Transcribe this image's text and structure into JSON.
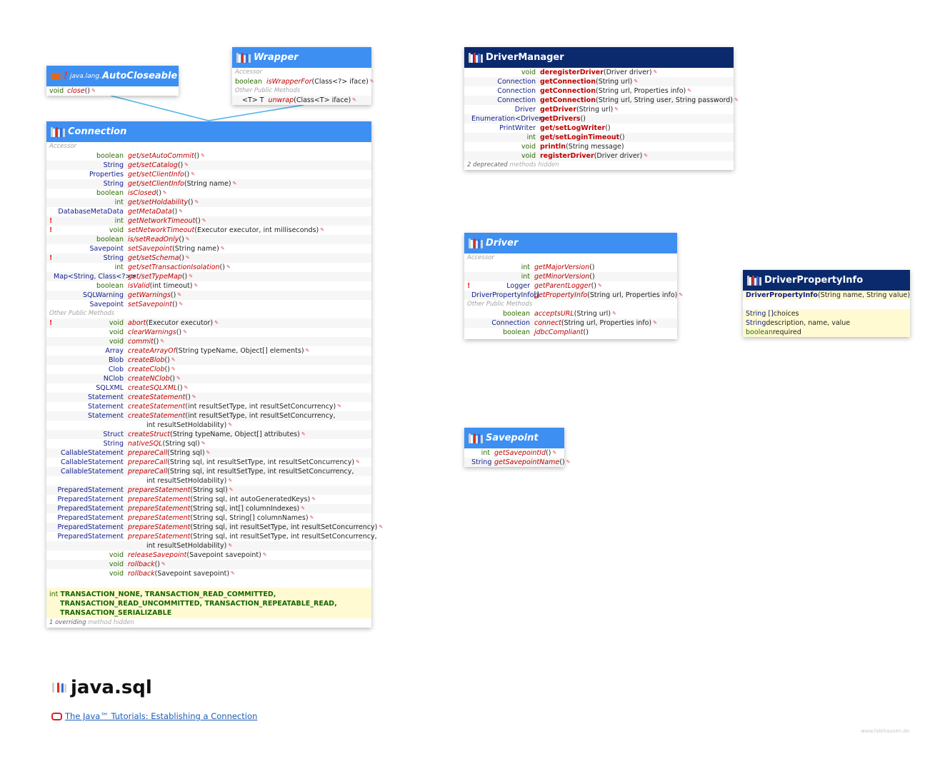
{
  "colors": {
    "interface_header": "#3d8ff2",
    "class_header": "#0b2a6e",
    "type": "#0e1c8c",
    "primitive": "#2b6b00",
    "method": "#c00000",
    "constants": "#186600",
    "connector": "#4fb4ee"
  },
  "auto": {
    "pkg": "java.lang.",
    "name": "AutoCloseable",
    "row_ret": "void",
    "row_name": "close",
    "row_params": " ()"
  },
  "wrapper": {
    "name": "Wrapper",
    "s1": "Accessor",
    "r1_ret": "boolean",
    "r1_name": "isWrapperFor",
    "r1_params": " (Class<?> iface)",
    "s2": "Other Public Methods",
    "r2_ret": "<T> T",
    "r2_name": "unwrap",
    "r2_params": " (Class<T> iface)"
  },
  "connection": {
    "name": "Connection",
    "rows": [
      {
        "s": "Accessor"
      },
      {
        "r": "boolean",
        "n": "get/setAutoCommit",
        "p": " ()",
        "t": "p"
      },
      {
        "r": "String",
        "n": "get/setCatalog",
        "p": " ()"
      },
      {
        "r": "Properties",
        "n": "get/setClientInfo",
        "p": " ()"
      },
      {
        "r": "String",
        "n": "get/setClientInfo",
        "p": " (String name)"
      },
      {
        "r": "boolean",
        "n": "isClosed",
        "p": " ()",
        "t": "p"
      },
      {
        "r": "int",
        "n": "get/setHoldability",
        "p": " ()",
        "t": "p"
      },
      {
        "r": "DatabaseMetaData",
        "n": "getMetaData",
        "p": " ()"
      },
      {
        "r": "int",
        "n": "getNetworkTimeout",
        "p": " ()",
        "t": "p",
        "b": "!"
      },
      {
        "r": "void",
        "n": "setNetworkTimeout",
        "p": " (Executor executor, int milliseconds)",
        "t": "p",
        "b": "!"
      },
      {
        "r": "boolean",
        "n": "is/setReadOnly",
        "p": " ()",
        "t": "p"
      },
      {
        "r": "Savepoint",
        "n": "setSavepoint",
        "p": " (String name)"
      },
      {
        "r": "String",
        "n": "get/setSchema",
        "p": " ()",
        "b": "!"
      },
      {
        "r": "int",
        "n": "get/setTransactionIsolation",
        "p": " ()",
        "t": "p"
      },
      {
        "r": "Map<String, Class<?>>",
        "n": "get/setTypeMap",
        "p": " ()"
      },
      {
        "r": "boolean",
        "n": "isValid",
        "p": " (int timeout)",
        "t": "p"
      },
      {
        "r": "SQLWarning",
        "n": "getWarnings",
        "p": " ()"
      },
      {
        "r": "Savepoint",
        "n": "setSavepoint",
        "p": " ()"
      },
      {
        "s": "Other Public Methods"
      },
      {
        "r": "void",
        "n": "abort",
        "p": " (Executor executor)",
        "t": "p",
        "b": "!"
      },
      {
        "r": "void",
        "n": "clearWarnings",
        "p": " ()",
        "t": "p"
      },
      {
        "r": "void",
        "n": "commit",
        "p": " ()",
        "t": "p"
      },
      {
        "r": "Array",
        "n": "createArrayOf",
        "p": " (String typeName, Object[] elements)"
      },
      {
        "r": "Blob",
        "n": "createBlob",
        "p": " ()"
      },
      {
        "r": "Clob",
        "n": "createClob",
        "p": " ()"
      },
      {
        "r": "NClob",
        "n": "createNClob",
        "p": " ()"
      },
      {
        "r": "SQLXML",
        "n": "createSQLXML",
        "p": " ()"
      },
      {
        "r": "Statement",
        "n": "createStatement",
        "p": " ()"
      },
      {
        "r": "Statement",
        "n": "createStatement",
        "p": " (int resultSetType, int resultSetConcurrency)"
      },
      {
        "r": "Statement",
        "n": "createStatement",
        "p": " (int resultSetType, int resultSetConcurrency,",
        "ne": 1
      },
      {
        "r": "",
        "n": "",
        "p": "int resultSetHoldability)",
        "c": 1
      },
      {
        "r": "Struct",
        "n": "createStruct",
        "p": " (String typeName, Object[] attributes)"
      },
      {
        "r": "String",
        "n": "nativeSQL",
        "p": " (String sql)"
      },
      {
        "r": "CallableStatement",
        "n": "prepareCall",
        "p": " (String sql)"
      },
      {
        "r": "CallableStatement",
        "n": "prepareCall",
        "p": " (String sql, int resultSetType, int resultSetConcurrency)"
      },
      {
        "r": "CallableStatement",
        "n": "prepareCall",
        "p": " (String sql, int resultSetType, int resultSetConcurrency,",
        "ne": 1
      },
      {
        "r": "",
        "n": "",
        "p": "int resultSetHoldability)",
        "c": 1
      },
      {
        "r": "PreparedStatement",
        "n": "prepareStatement",
        "p": " (String sql)"
      },
      {
        "r": "PreparedStatement",
        "n": "prepareStatement",
        "p": " (String sql, int autoGeneratedKeys)"
      },
      {
        "r": "PreparedStatement",
        "n": "prepareStatement",
        "p": " (String sql, int[] columnIndexes)"
      },
      {
        "r": "PreparedStatement",
        "n": "prepareStatement",
        "p": " (String sql, String[] columnNames)"
      },
      {
        "r": "PreparedStatement",
        "n": "prepareStatement",
        "p": " (String sql, int resultSetType, int resultSetConcurrency)"
      },
      {
        "r": "PreparedStatement",
        "n": "prepareStatement",
        "p": " (String sql, int resultSetType, int resultSetConcurrency,",
        "ne": 1
      },
      {
        "r": "",
        "n": "",
        "p": "int resultSetHoldability)",
        "c": 1
      },
      {
        "r": "void",
        "n": "releaseSavepoint",
        "p": " (Savepoint savepoint)",
        "t": "p"
      },
      {
        "r": "void",
        "n": "rollback",
        "p": " ()",
        "t": "p"
      },
      {
        "r": "void",
        "n": "rollback",
        "p": " (Savepoint savepoint)",
        "t": "p"
      }
    ],
    "field_type": "int",
    "fields_l1": "TRANSACTION_NONE, TRANSACTION_READ_COMMITTED,",
    "fields_l2": "TRANSACTION_READ_UNCOMMITTED, TRANSACTION_REPEATABLE_READ,",
    "fields_l3": "TRANSACTION_SERIALIZABLE",
    "foot_count": "1 overriding",
    "foot_rest": " method hidden"
  },
  "drivermanager": {
    "name": "DriverManager",
    "rows": [
      {
        "r": "void",
        "n": "deregisterDriver",
        "p": " (Driver driver)",
        "t": "p"
      },
      {
        "r": "Connection",
        "n": "getConnection",
        "p": " (String url)"
      },
      {
        "r": "Connection",
        "n": "getConnection",
        "p": " (String url, Properties info)"
      },
      {
        "r": "Connection",
        "n": "getConnection",
        "p": " (String url, String user, String password)"
      },
      {
        "r": "Driver",
        "n": "getDriver",
        "p": " (String url)"
      },
      {
        "r": "Enumeration<Driver>",
        "n": "getDrivers",
        "p": " ()",
        "ne": 1
      },
      {
        "r": "PrintWriter",
        "n": "get/setLogWriter",
        "p": " ()",
        "ne": 1
      },
      {
        "r": "int",
        "n": "get/setLoginTimeout",
        "p": " ()",
        "t": "p",
        "ne": 1
      },
      {
        "r": "void",
        "n": "println",
        "p": " (String message)",
        "t": "p",
        "ne": 1
      },
      {
        "r": "void",
        "n": "registerDriver",
        "p": " (Driver driver)",
        "t": "p"
      }
    ],
    "foot_count": "2 deprecated",
    "foot_rest": " methods hidden"
  },
  "driver": {
    "name": "Driver",
    "rows": [
      {
        "s": "Accessor"
      },
      {
        "r": "int",
        "n": "getMajorVersion",
        "p": " ()",
        "t": "p",
        "ne": 1
      },
      {
        "r": "int",
        "n": "getMinorVersion",
        "p": " ()",
        "t": "p",
        "ne": 1
      },
      {
        "r": "Logger",
        "n": "getParentLogger",
        "p": " ()",
        "b": "!"
      },
      {
        "r": "DriverPropertyInfo[]",
        "n": "getPropertyInfo",
        "p": " (String url, Properties info)"
      },
      {
        "s": "Other Public Methods"
      },
      {
        "r": "boolean",
        "n": "acceptsURL",
        "p": " (String url)",
        "t": "p"
      },
      {
        "r": "Connection",
        "n": "connect",
        "p": " (String url, Properties info)"
      },
      {
        "r": "boolean",
        "n": "jdbcCompliant",
        "p": " ()",
        "t": "p",
        "ne": 1
      }
    ]
  },
  "dpi": {
    "name": "DriverPropertyInfo",
    "ctor_name": "DriverPropertyInfo",
    "ctor_params": " (String name, String value)",
    "f1_type": "String []",
    "f1_name": " choices",
    "f2_type": "String",
    "f2_name": " description, name, value",
    "f3_type": "boolean",
    "f3_name": " required"
  },
  "savepoint": {
    "name": "Savepoint",
    "rows": [
      {
        "r": "int",
        "n": "getSavepointId",
        "p": " ()",
        "t": "p"
      },
      {
        "r": "String",
        "n": "getSavepointName",
        "p": " ()"
      }
    ]
  },
  "page": {
    "title": "java.sql",
    "link": "The Java™ Tutorials: Establishing a Connection",
    "watermark": "www.falkhausen.de"
  }
}
